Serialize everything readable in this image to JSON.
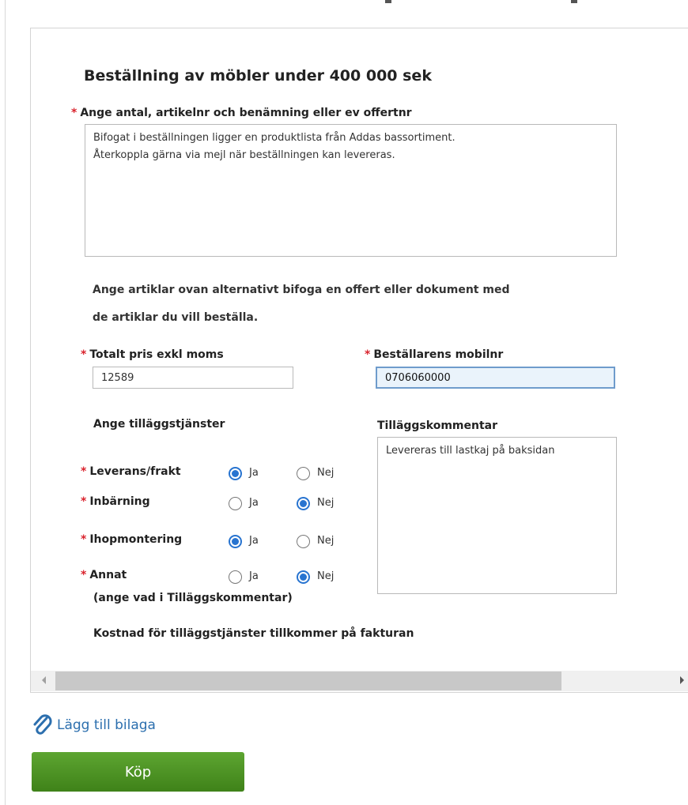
{
  "form": {
    "title": "Beställning av möbler under 400 000 sek",
    "articles": {
      "label": "Ange antal, artikelnr och benämning eller ev offertnr",
      "value_line1": "Bifogat i beställningen ligger en produktlista från Addas bassortiment.",
      "value_line2": "Återkoppla gärna via mejl när beställningen kan levereras."
    },
    "info_line1": "Ange artiklar ovan alternativt bifoga en offert eller dokument med",
    "info_line2": "de artiklar du vill beställa.",
    "total_price": {
      "label": "Totalt pris exkl moms",
      "value": "12589"
    },
    "mobile": {
      "label": "Beställarens mobilnr",
      "value": "0706060000"
    },
    "extra_services_heading": "Ange tilläggstjänster",
    "comment": {
      "label": "Tilläggskommentar",
      "value": "Levereras till lastkaj på baksidan"
    },
    "required_mark": "*",
    "yes_label": "Ja",
    "no_label": "Nej",
    "services": [
      {
        "label": "Leverans/frakt",
        "selected": "Ja"
      },
      {
        "label": "Inbärning",
        "selected": "Nej"
      },
      {
        "label": "Ihopmontering",
        "selected": "Ja"
      },
      {
        "label": "Annat",
        "selected": "Nej"
      }
    ],
    "annat_note": "(ange vad i Tilläggskommentar)",
    "cost_note": "Kostnad för tilläggstjänster tillkommer på fakturan"
  },
  "attachment_link": "Lägg till bilaga",
  "buy_button": "Köp",
  "colors": {
    "required": "#d9232d",
    "link": "#2c6fae",
    "button": "#4a901f",
    "radio": "#2874d0"
  }
}
